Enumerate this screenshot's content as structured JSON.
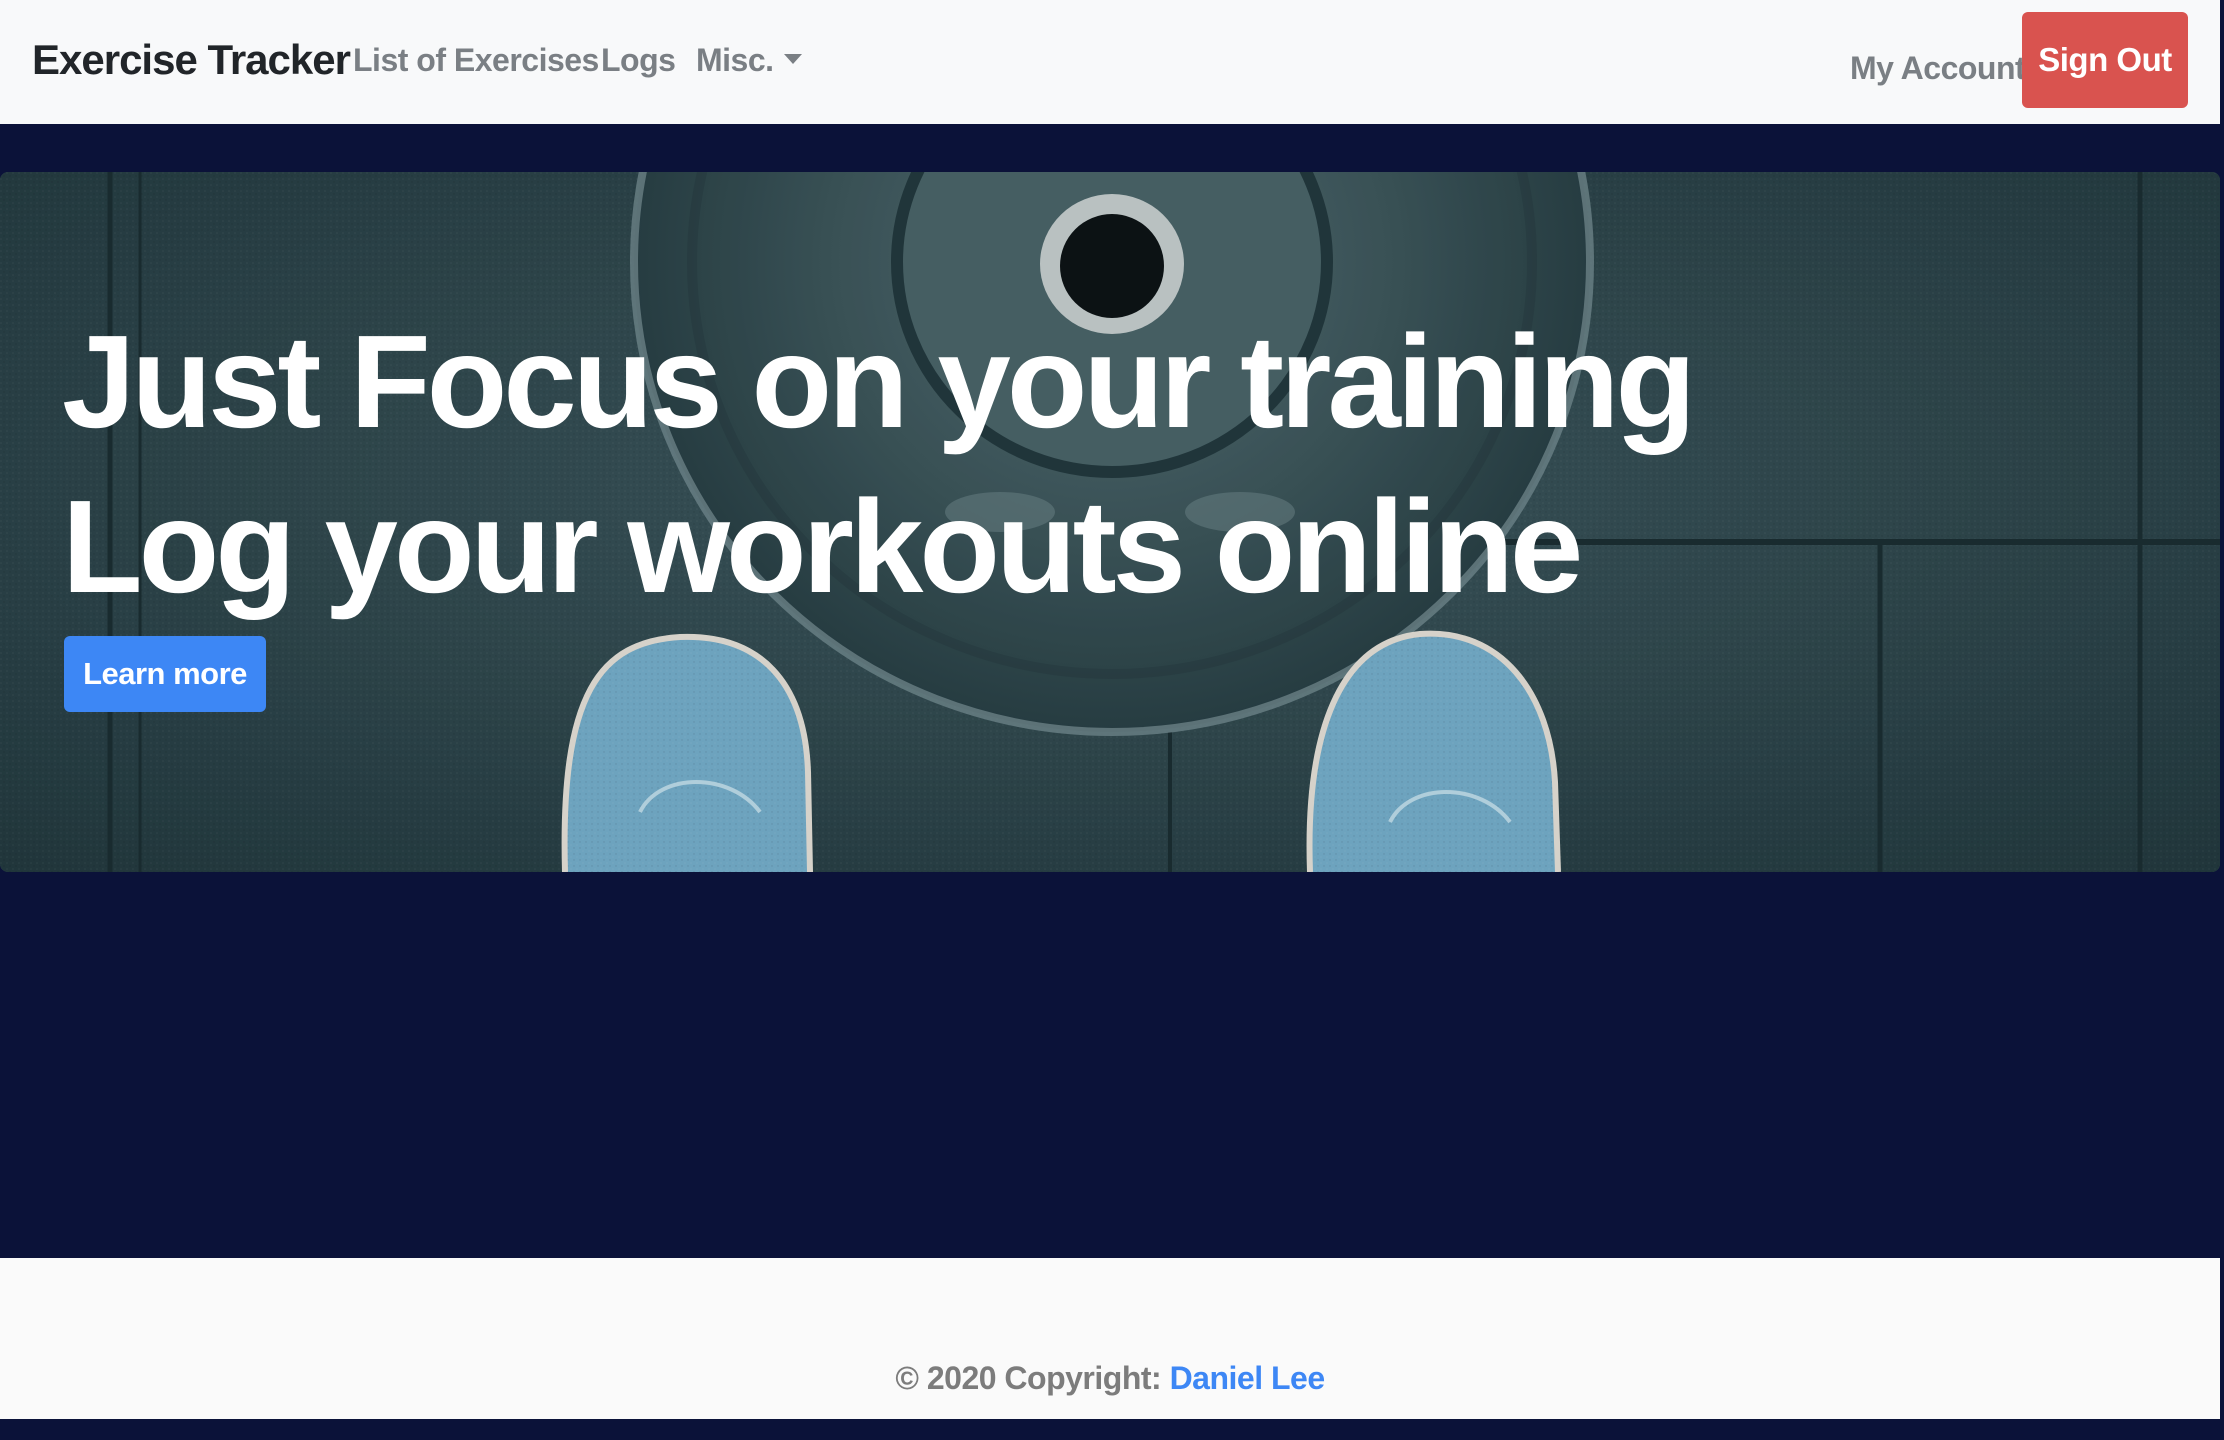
{
  "navbar": {
    "brand": "Exercise Tracker",
    "links": [
      {
        "label": "List of Exercises"
      },
      {
        "label": "Logs"
      },
      {
        "label": "Misc."
      }
    ],
    "account_label": "My Account",
    "signout_label": "Sign Out"
  },
  "hero": {
    "title_line1": "Just Focus on your training",
    "title_line2": "Log your workouts online",
    "button_label": "Learn more"
  },
  "footer": {
    "copyright_prefix": "© 2020 Copyright: ",
    "author": "Daniel Lee"
  },
  "colors": {
    "page_background": "#0b1239",
    "navbar_background": "#f8f9fa",
    "signout_button": "#d9534f",
    "primary_button": "#3d87f5",
    "link": "#3d87f5"
  },
  "icons": {
    "dropdown": "caret-down-icon"
  }
}
